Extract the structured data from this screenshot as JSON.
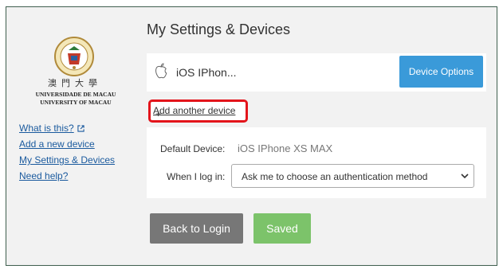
{
  "logo": {
    "chinese": "澳門大學",
    "portuguese": "UNIVERSIDADE DE MACAU",
    "english": "UNIVERSITY OF MACAU"
  },
  "sidebar": {
    "links": [
      {
        "label": "What is this?"
      },
      {
        "label": "Add a new device"
      },
      {
        "label": "My Settings & Devices"
      },
      {
        "label": "Need help?"
      }
    ]
  },
  "main": {
    "title": "My Settings & Devices",
    "device": {
      "icon": "apple-icon",
      "name": "iOS IPhon...",
      "options_label": "Device Options"
    },
    "add_device": {
      "prefix": "+ ",
      "label": "Add another device"
    },
    "settings": {
      "default_device_label": "Default Device:",
      "default_device_value": "iOS IPhone XS MAX",
      "login_label": "When I log in:",
      "login_selected": "Ask me to choose an authentication method"
    },
    "buttons": {
      "back": "Back to Login",
      "saved": "Saved"
    }
  },
  "colors": {
    "accent_blue": "#3a9ad9",
    "saved_green": "#7cc36a",
    "back_gray": "#777777",
    "highlight_red": "#e3141b",
    "link_blue": "#1a5a9e"
  }
}
